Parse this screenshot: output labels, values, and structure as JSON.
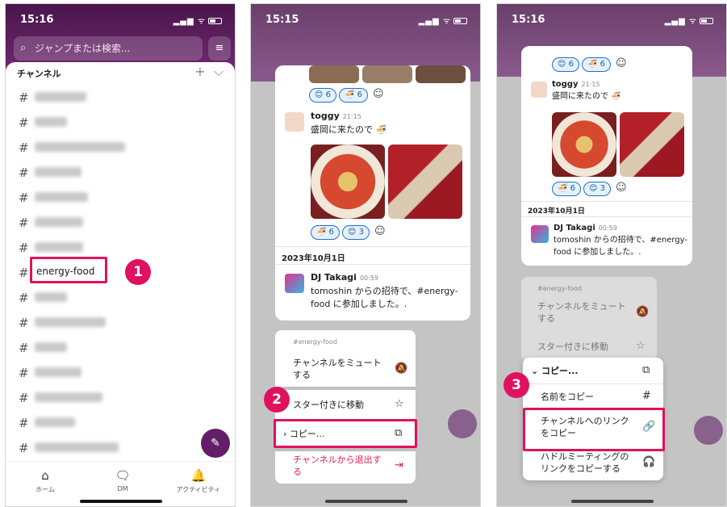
{
  "status": {
    "time1": "15:16",
    "time2": "15:15",
    "time3": "15:16",
    "signal": "▂▄▆ ᯤ"
  },
  "panel1": {
    "search_placeholder": "ジャンプまたは検索...",
    "section_title": "チャンネル",
    "highlight_channel": "energy-food",
    "step": "1",
    "nav": {
      "home": "ホーム",
      "dm": "DM",
      "activity": "アクティビティ"
    }
  },
  "panel2": {
    "reactions_top": [
      "😊 6",
      "🍜 6"
    ],
    "message1": {
      "author": "toggy",
      "time": "21:15",
      "text": "盛岡に来たので 🍜"
    },
    "reactions_mid": [
      "🍜 6",
      "😊 3"
    ],
    "date": "2023年10月1日",
    "message2": {
      "author": "DJ Takagi",
      "time": "00:59",
      "text": "tomoshin からの招待で、#energy-food に参加しました。."
    },
    "menu": {
      "channel": "#energy-food",
      "mute": "チャンネルをミュートする",
      "star": "スター付きに移動",
      "copy": "コピー...",
      "leave": "チャンネルから退出する"
    },
    "step": "2"
  },
  "panel3": {
    "reactions_top": [
      "😊 6",
      "🍜 6"
    ],
    "message1": {
      "author": "toggy",
      "time": "21:15",
      "text": "盛岡に来たので 🍜"
    },
    "reactions_mid": [
      "🍜 6",
      "😊 3"
    ],
    "date": "2023年10月1日",
    "message2": {
      "author": "DJ Takagi",
      "time": "00:59",
      "text": "tomoshin からの招待で、#energy-food に参加しました。."
    },
    "bg_menu": {
      "channel": "#energy-food",
      "mute": "チャンネルをミュートする",
      "star": "スター付きに移動"
    },
    "copy_menu": {
      "header": "コピー...",
      "copy_name": "名前をコピー",
      "copy_link": "チャンネルへのリンクをコピー",
      "copy_huddle": "ハドルミーティングのリンクをコピーする"
    },
    "step": "3"
  },
  "colors": {
    "aubergine": "#4a154b",
    "highlight": "#e0115f",
    "link_blue": "#1264a3",
    "danger": "#e01e5a"
  }
}
